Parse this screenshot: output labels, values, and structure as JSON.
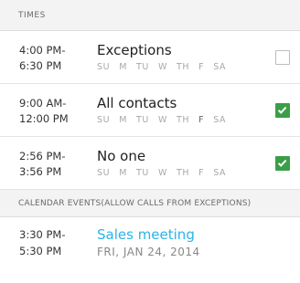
{
  "sections": {
    "times_header": "TIMES",
    "calendar_header": "CALENDAR EVENTS(ALLOW CALLS FROM EXCEPTIONS)"
  },
  "rows": [
    {
      "start": "4:00 PM-",
      "end": "6:30 PM",
      "title": "Exceptions",
      "days": [
        "SU",
        "M",
        "TU",
        "W",
        "TH",
        "F",
        "SA"
      ],
      "checked": false
    },
    {
      "start": "9:00 AM-",
      "end": "12:00 PM",
      "title": "All contacts",
      "days": [
        "SU",
        "M",
        "TU",
        "W",
        "TH",
        "F",
        "SA"
      ],
      "checked": true
    },
    {
      "start": "2:56 PM-",
      "end": "3:56 PM",
      "title": "No one",
      "days": [
        "SU",
        "M",
        "TU",
        "W",
        "TH",
        "F",
        "SA"
      ],
      "checked": true
    }
  ],
  "event": {
    "start": "3:30 PM-",
    "end": "5:30 PM",
    "title": "Sales meeting",
    "date": "FRI, JAN 24, 2014"
  },
  "colors": {
    "check_green": "#3a9e47",
    "event_title": "#29b5e8"
  }
}
